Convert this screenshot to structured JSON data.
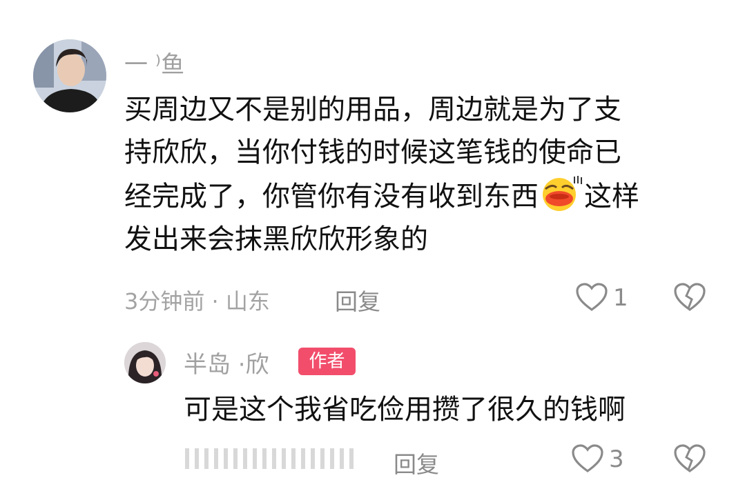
{
  "comments": [
    {
      "username": "一 ⁾鱼",
      "content_line1": "买周边又不是别的用品，周边就是为了支",
      "content_line2": "持欣欣，当你付钱的时候这笔钱的使命已",
      "content_line3_before": "经完成了，你管你有没有收到东西",
      "content_line3_after": "这样",
      "content_line4": "发出来会抹黑欣欣形象的",
      "emoji": "duck-lips-emoji",
      "meta": "3分钟前 · 山东",
      "reply_label": "回复",
      "like_count": "1"
    },
    {
      "username": "半岛 ·欣",
      "badge": "作者",
      "content": "可是这个我省吃俭用攒了很久的钱啊",
      "reply_label": "回复",
      "like_count": "3"
    }
  ],
  "colors": {
    "badge": "#f24e6c",
    "meta": "#a3a3a3",
    "text": "#111111"
  }
}
